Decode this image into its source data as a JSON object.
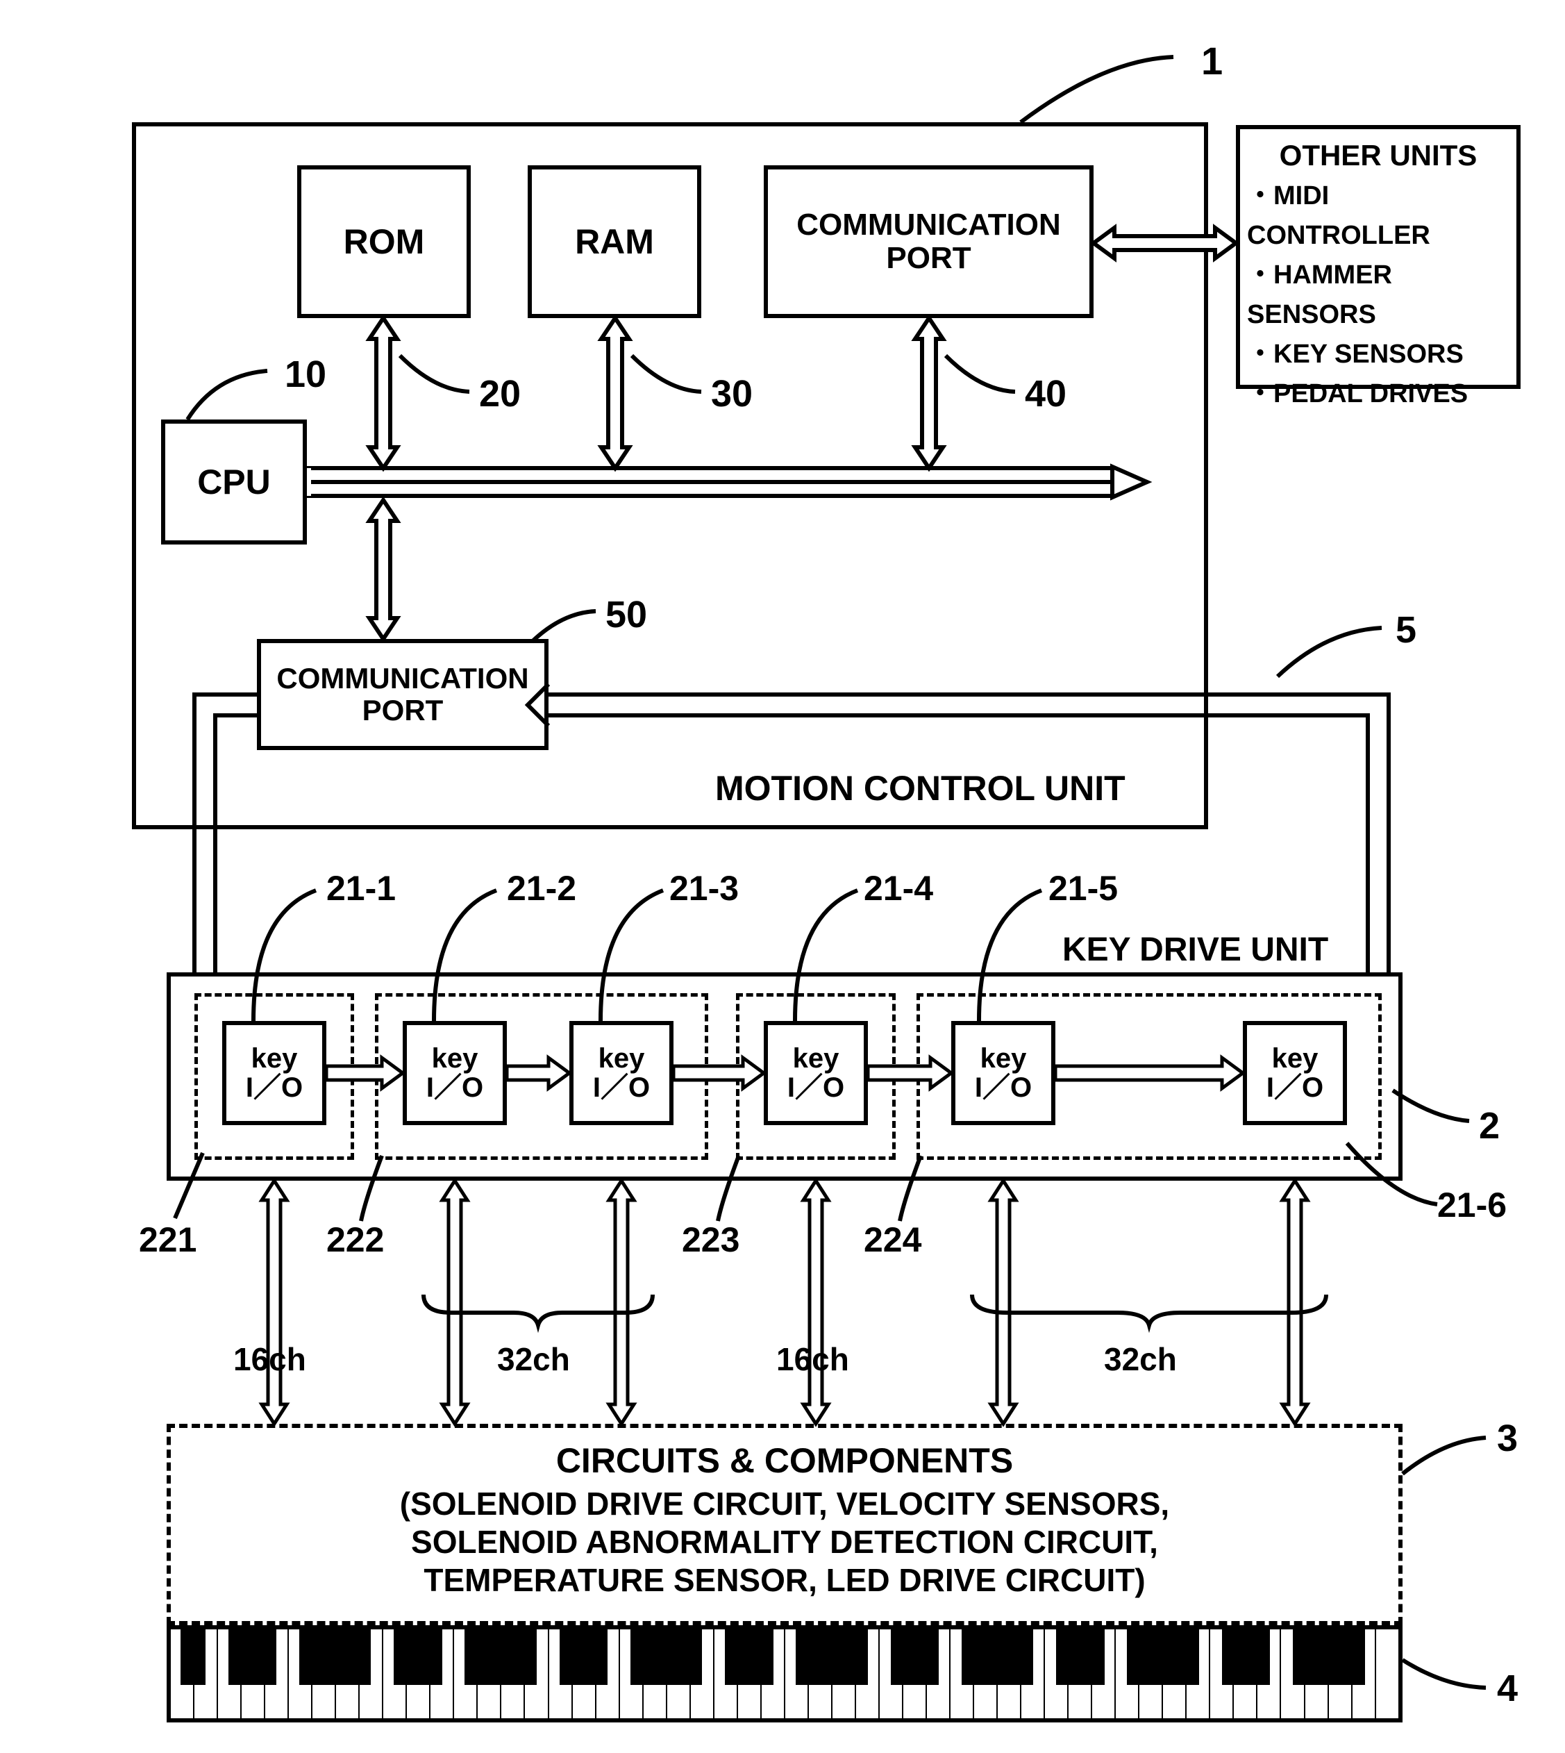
{
  "refs": {
    "mcu": "1",
    "cpu_ref": "10",
    "rom_ref": "20",
    "ram_ref": "30",
    "comm_port1_ref": "40",
    "comm_port2_ref": "50",
    "kdu": "2",
    "bus_loop": "5",
    "circuits_ref": "3",
    "keyboard_ref": "4",
    "keyio_refs": [
      "21-1",
      "21-2",
      "21-3",
      "21-4",
      "21-5",
      "21-6"
    ],
    "group_refs": [
      "221",
      "222",
      "223",
      "224"
    ],
    "ch_labels": [
      "16ch",
      "32ch",
      "16ch",
      "32ch"
    ]
  },
  "blocks": {
    "cpu": "CPU",
    "rom": "ROM",
    "ram": "RAM",
    "comm_port1": "COMMUNICATION\nPORT",
    "comm_port2": "COMMUNICATION\nPORT",
    "mcu_label": "MOTION CONTROL UNIT",
    "kdu_label": "KEY DRIVE UNIT",
    "keyio": "key\nI／O",
    "other_units_title": "OTHER UNITS",
    "other_units_items": [
      "・MIDI CONTROLLER",
      "・HAMMER SENSORS",
      "・KEY SENSORS",
      "・PEDAL DRIVES"
    ],
    "circuits_title": "CIRCUITS & COMPONENTS",
    "circuits_body": "(SOLENOID DRIVE CIRCUIT, VELOCITY SENSORS,\nSOLENOID ABNORMALITY DETECTION CIRCUIT,\nTEMPERATURE SENSOR, LED DRIVE CIRCUIT)"
  }
}
